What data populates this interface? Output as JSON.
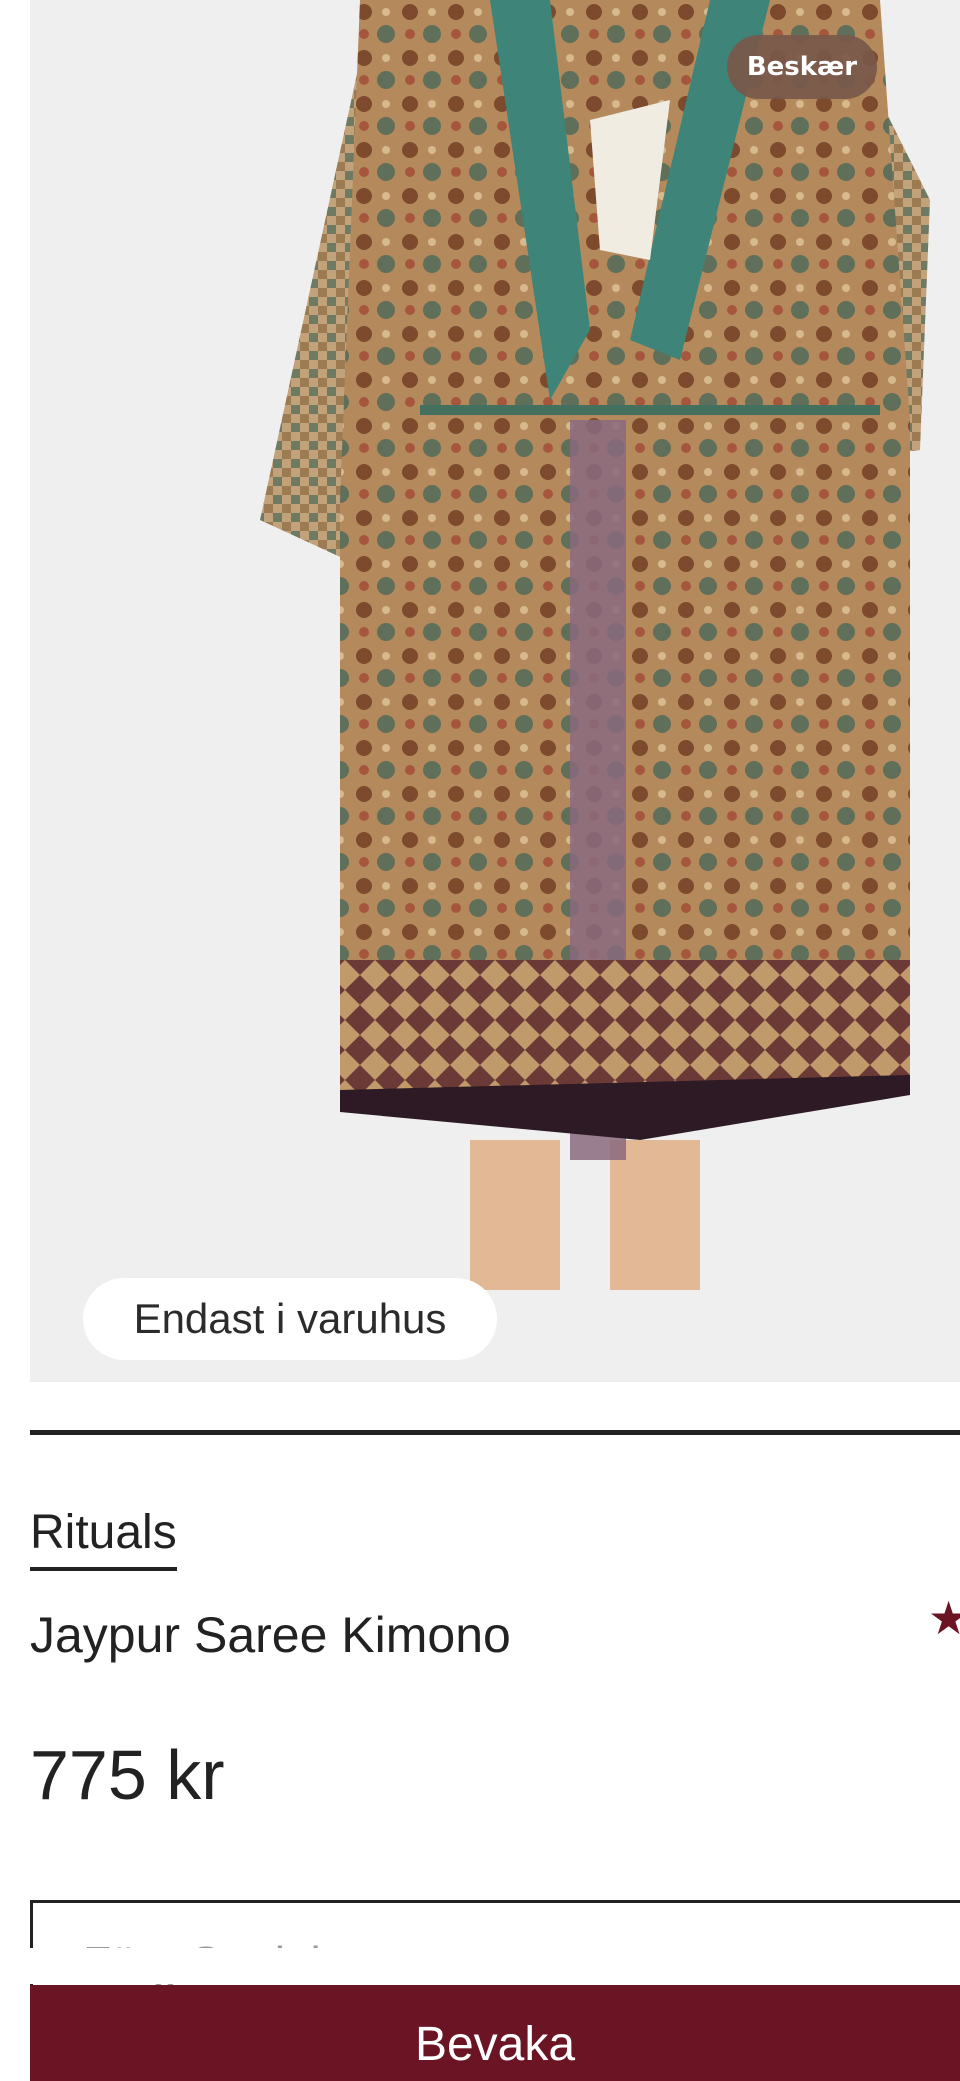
{
  "image": {
    "crop_label": "Beskær",
    "availability_badge": "Endast i varuhus"
  },
  "product": {
    "brand": "Rituals",
    "title": "Jaypur Saree Kimono",
    "price": "775 kr",
    "rating_icon": "star-icon",
    "rating_color": "#6a1424"
  },
  "selector": {
    "placeholder": "Färg Storlek"
  },
  "actions": {
    "primary_label": "Bevaka",
    "primary_color": "#6a1424"
  }
}
